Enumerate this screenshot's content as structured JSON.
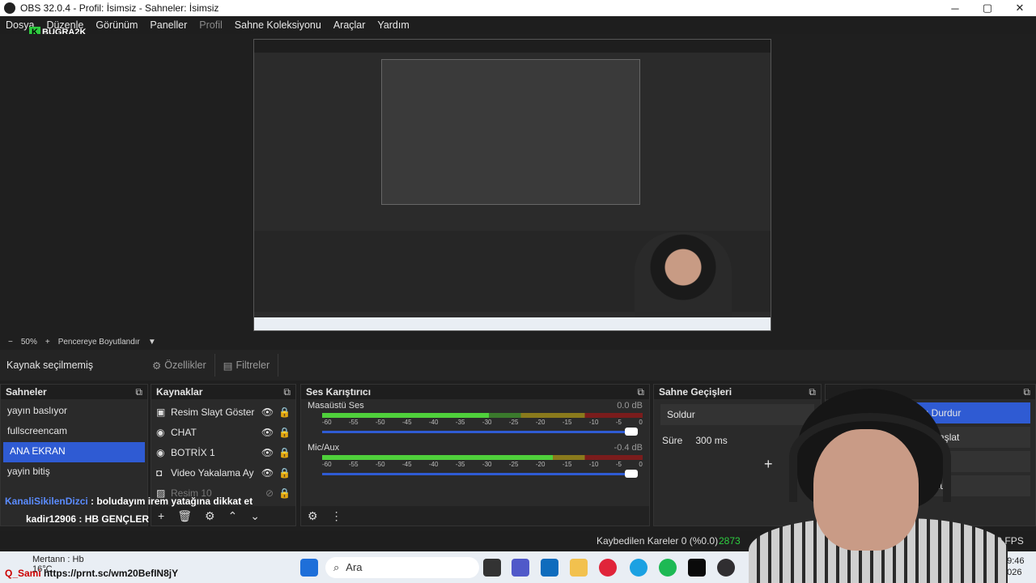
{
  "window": {
    "title": "OBS 32.0.4 - Profil: İsimsiz - Sahneler: İsimsiz",
    "minimize": "─",
    "maximize": "▢",
    "close": "✕"
  },
  "menu": [
    "Dosya",
    "Düzenle",
    "Görünüm",
    "Paneller",
    "Profil",
    "Sahne Koleksiyonu",
    "Araçlar",
    "Yardım"
  ],
  "watermark": "BUGRA2K",
  "zoom": {
    "minus": "−",
    "value": "50%",
    "plus": "+",
    "mode": "Pencereye Boyutlandır",
    "dropdown": "▼"
  },
  "source_toolbar": {
    "no_selection": "Kaynak seçilmemiş",
    "properties": "Özellikler",
    "filters": "Filtreler"
  },
  "scenes": {
    "title": "Sahneler",
    "items": [
      "yayın baslıyor",
      "fullscreencam",
      "ANA EKRAN",
      "yayin bitiş"
    ],
    "active_index": 2
  },
  "sources": {
    "title": "Kaynaklar",
    "items": [
      "Resim Slayt Göster",
      "CHAT",
      "BOTRİX 1",
      "Video Yakalama Ay",
      "Resim 10"
    ]
  },
  "mixer": {
    "title": "Ses Karıştırıcı",
    "channels": [
      {
        "name": "Masaüstü Ses",
        "db": "0.0 dB",
        "level": 0.52
      },
      {
        "name": "Mic/Aux",
        "db": "-0.4 dB",
        "level": 0.72
      }
    ],
    "ticks": [
      "-60",
      "-55",
      "-50",
      "-45",
      "-40",
      "-35",
      "-30",
      "-25",
      "-20",
      "-15",
      "-10",
      "-5",
      "0"
    ]
  },
  "transitions": {
    "title": "Sahne Geçişleri",
    "type": "Soldur",
    "duration_label": "Süre",
    "duration_value": "300 ms"
  },
  "controls": {
    "stop_stream": "yını Durdur",
    "start_record": "Kay Başlat",
    "virtual_cam": "yı Başlat",
    "studio_mode": "o Modu"
  },
  "chat": {
    "msg1_user": "KanaliSikilenDizci",
    "msg1_text": ": boludayım irem yatağına dikkat et",
    "msg2_user": "kadir12906",
    "msg2_text": ": HB GENÇLER",
    "msg3_user": "kadir12906",
    "msg3_text": ":"
  },
  "status": {
    "dropped": "Kaybedilen Kareler 0 (%0.0)",
    "cpu": "2873",
    "fps": "30.00 FPS"
  },
  "taskbar": {
    "search": "Ara",
    "time": "19:46",
    "date": "2026",
    "weather": "16°C",
    "overlay_user": "Mertann",
    "overlay_text": ": Hb",
    "link_user": "Q_Sami",
    "link_text": "https://prnt.sc/wm20BefIN8jY"
  },
  "colors": {
    "accent": "#2f5bd3",
    "meter_green": "#4fd03b",
    "brand": "#2ecc40"
  }
}
